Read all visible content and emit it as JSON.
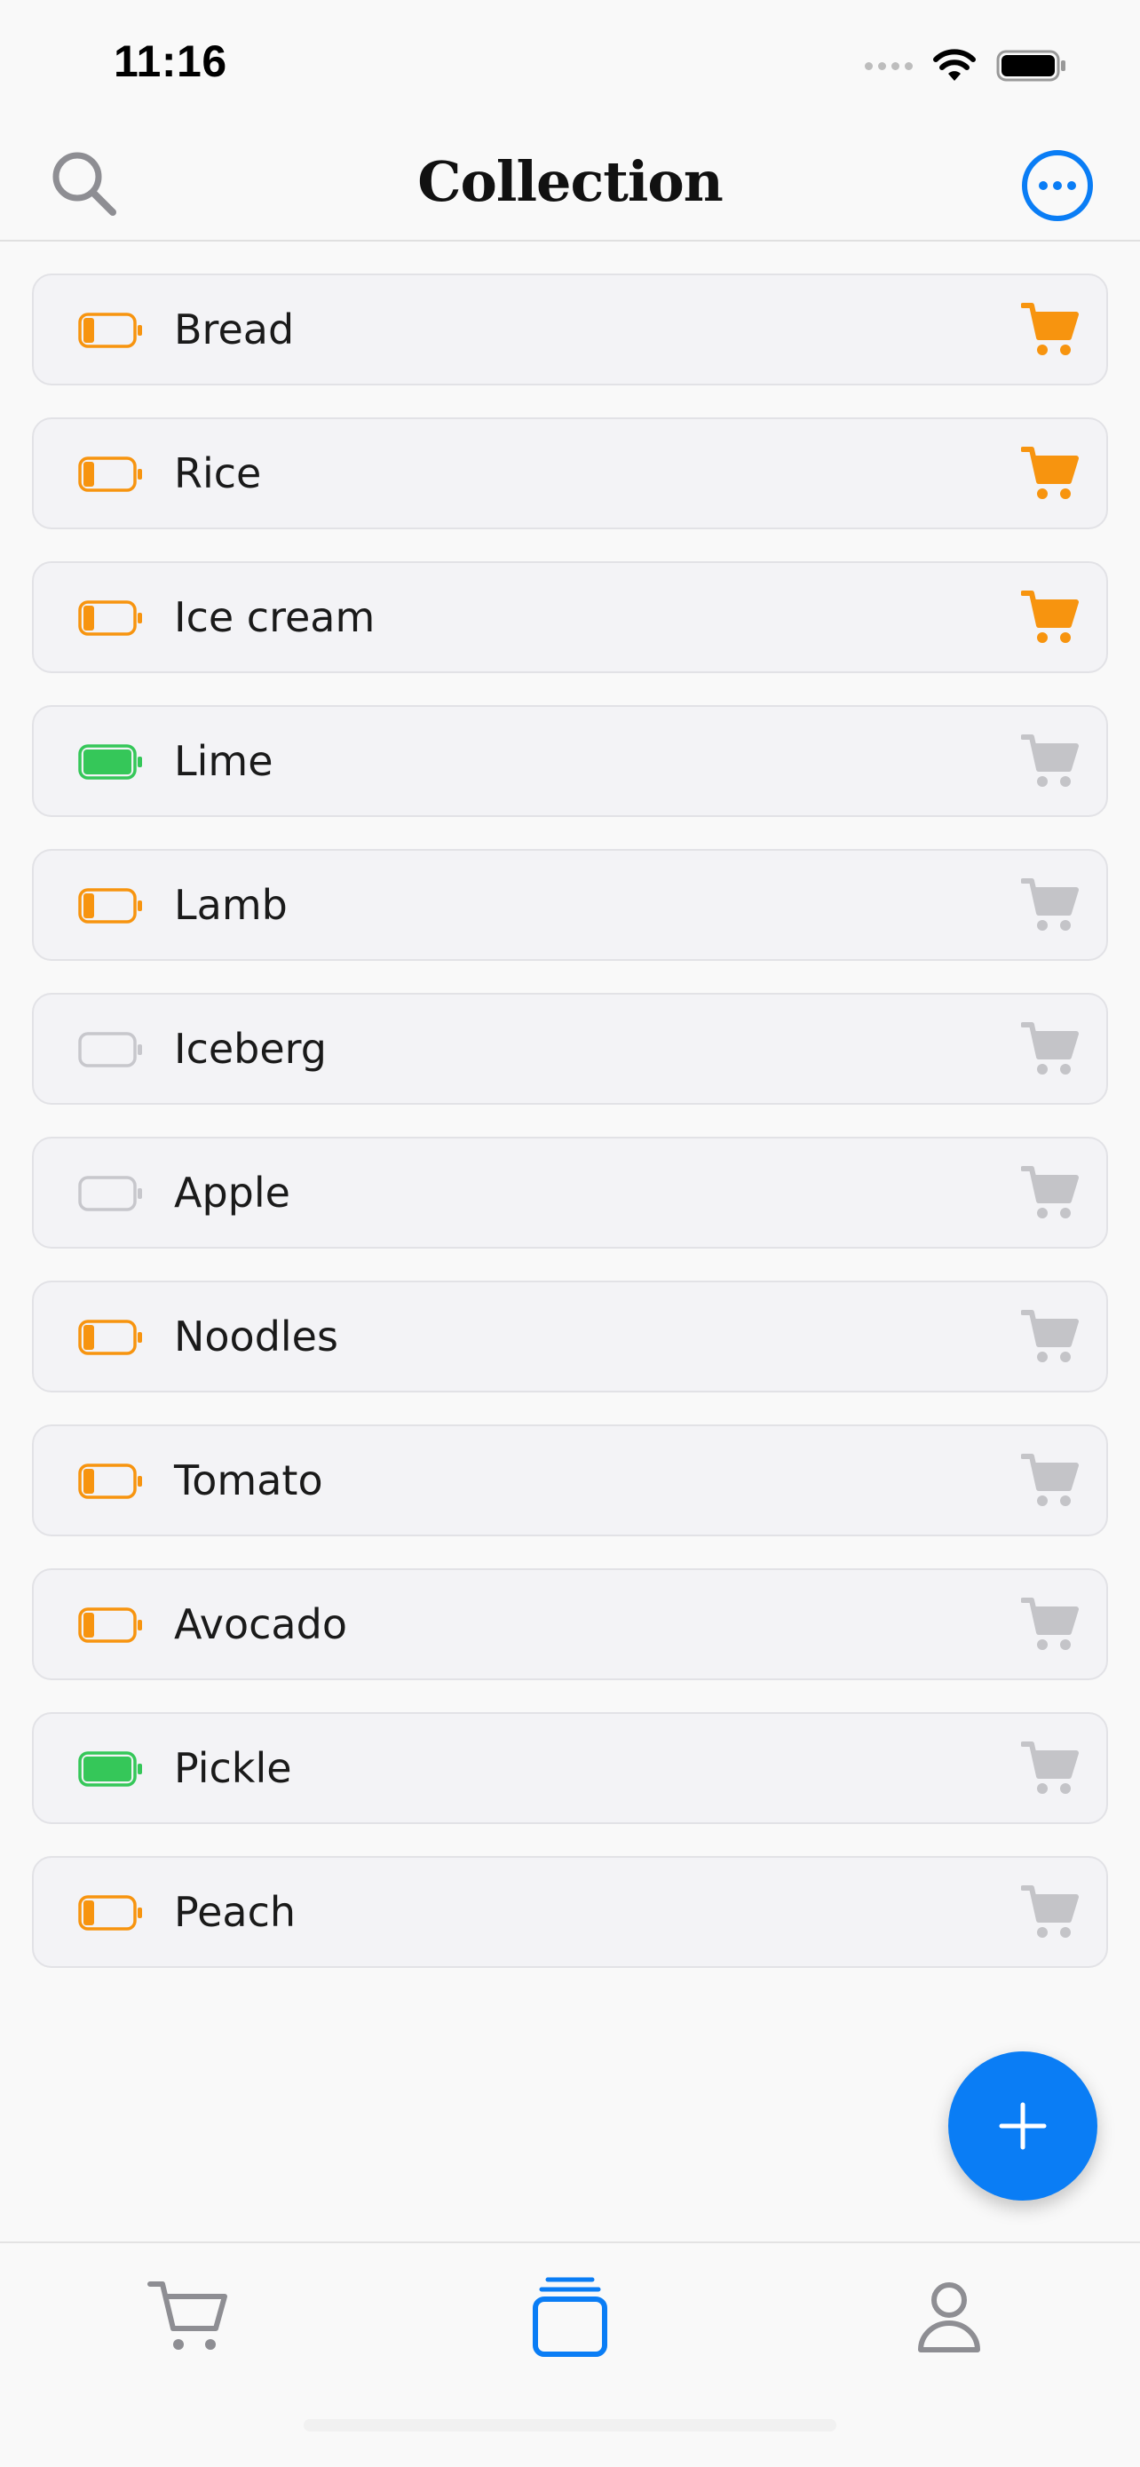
{
  "status_bar": {
    "time": "11:16"
  },
  "header": {
    "title": "Collection"
  },
  "items": [
    {
      "label": "Bread",
      "battery": "low",
      "in_cart": true
    },
    {
      "label": "Rice",
      "battery": "low",
      "in_cart": true
    },
    {
      "label": "Ice cream",
      "battery": "low",
      "in_cart": true
    },
    {
      "label": "Lime",
      "battery": "full",
      "in_cart": false
    },
    {
      "label": "Lamb",
      "battery": "low",
      "in_cart": false
    },
    {
      "label": "Iceberg",
      "battery": "empty",
      "in_cart": false
    },
    {
      "label": "Apple",
      "battery": "empty",
      "in_cart": false
    },
    {
      "label": "Noodles",
      "battery": "low",
      "in_cart": false
    },
    {
      "label": "Tomato",
      "battery": "low",
      "in_cart": false
    },
    {
      "label": "Avocado",
      "battery": "low",
      "in_cart": false
    },
    {
      "label": "Pickle",
      "battery": "full",
      "in_cart": false
    },
    {
      "label": "Peach",
      "battery": "low",
      "in_cart": false
    }
  ],
  "icons": {
    "search": "search-icon",
    "more": "more-circle-icon",
    "battery": "battery-icon",
    "cart": "cart-icon",
    "add": "plus-icon",
    "tab_cart": "cart-icon",
    "tab_collection": "stack-icon",
    "tab_profile": "person-icon"
  },
  "colors": {
    "accent": "#0a7df5",
    "battery_low": "#f7940f",
    "battery_full": "#35c759",
    "battery_empty": "#c7c7cc",
    "cart_active": "#f7940f",
    "cart_inactive": "#c4c4c8",
    "tab_inactive": "#8e8e93"
  },
  "tabs": [
    {
      "name": "cart",
      "active": false
    },
    {
      "name": "collection",
      "active": true
    },
    {
      "name": "profile",
      "active": false
    }
  ]
}
